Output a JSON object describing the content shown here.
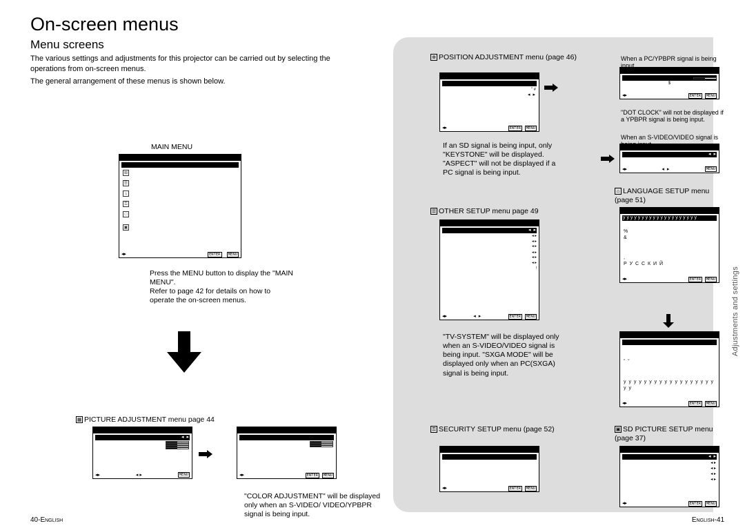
{
  "spacer": " ",
  "title": "On-screen menus",
  "section": "Menu screens",
  "intro1": "The various settings and adjustments for this projector can be carried out by selecting the operations from on-screen menus.",
  "intro2": "The general arrangement of these menus is shown below.",
  "sideTab": "Adjustments and settings",
  "screens": {
    "enter": "ENTER",
    "menu": "MENU"
  },
  "main": {
    "title": "MAIN MENU",
    "note1": "Press the MENU button to display the \"MAIN MENU\".",
    "note2": "Refer to page 42 for details on how to operate the on-screen menus."
  },
  "picture": {
    "title": "PICTURE ADJUSTMENT menu  page 44",
    "note": "\"COLOR ADJUSTMENT\" will be displayed only when an S-VIDEO/ VIDEO/YPBPR signal is being input."
  },
  "position": {
    "title": "POSITION ADJUSTMENT menu (page 46)",
    "note": "If an SD signal is being input, only \"KEYSTONE\" will be displayed. \"ASPECT\" will not be displayed if a PC signal is being input.",
    "r1cap": "When a PC/YPBPR signal is being input",
    "r1note": "\"DOT CLOCK\" will not be displayed if a YPBPR signal is being input.",
    "r2cap": "When an S-VIDEO/VIDEO signal is being input"
  },
  "other": {
    "title": "OTHER SETUP menu  page 49",
    "note": "\"TV-SYSTEM\" will be displayed only when an S-VIDEO/VIDEO signal is being input. \"SXGA MODE\" will be displayed only when an PC(SXGA) signal is being input."
  },
  "language": {
    "title": "LANGUAGE SETUP menu (page 51)",
    "marks": "y y y y y y y y y y y y y y y y y y y y",
    "pct": "%",
    "amp": "&",
    "comma": ",",
    "ru": "Р У С С К И Й",
    "dots": "˘   ˘"
  },
  "security": {
    "title": "SECURITY SETUP menu (page 52)"
  },
  "sd": {
    "title": "SD PICTURE SETUP menu (page 37)"
  },
  "footer": {
    "leftNum": "40-",
    "leftText": "English",
    "rightText": "English",
    "rightNum": "-41"
  }
}
